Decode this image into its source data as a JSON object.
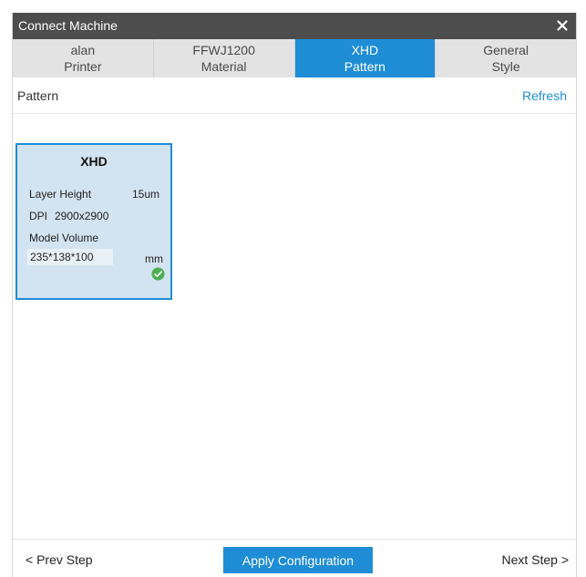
{
  "window": {
    "title": "Connect Machine",
    "close_icon": "close-icon"
  },
  "tabs": [
    {
      "line1": "alan",
      "line2": "Printer",
      "active": false
    },
    {
      "line1": "FFWJ1200",
      "line2": "Material",
      "active": false
    },
    {
      "line1": "XHD",
      "line2": "Pattern",
      "active": true
    },
    {
      "line1": "General",
      "line2": "Style",
      "active": false
    }
  ],
  "section": {
    "label": "Pattern",
    "refresh_label": "Refresh"
  },
  "pattern_card": {
    "title": "XHD",
    "layer_height_label": "Layer Height",
    "layer_height_value": "15um",
    "dpi_label": "DPI",
    "dpi_value": "2900x2900",
    "model_volume_label": "Model Volume",
    "model_volume_value": "235*138*100",
    "model_volume_unit": "mm",
    "selected_icon": "check-circle-icon",
    "selected": true
  },
  "footer": {
    "prev_label": "< Prev Step",
    "apply_label": "Apply Configuration",
    "next_label": "Next Step >"
  },
  "colors": {
    "accent": "#1f8dd6",
    "titlebar": "#4d4d4d",
    "tab_inactive": "#e3e3e3",
    "card_bg": "#d2e3f1",
    "success": "#4caf50"
  }
}
